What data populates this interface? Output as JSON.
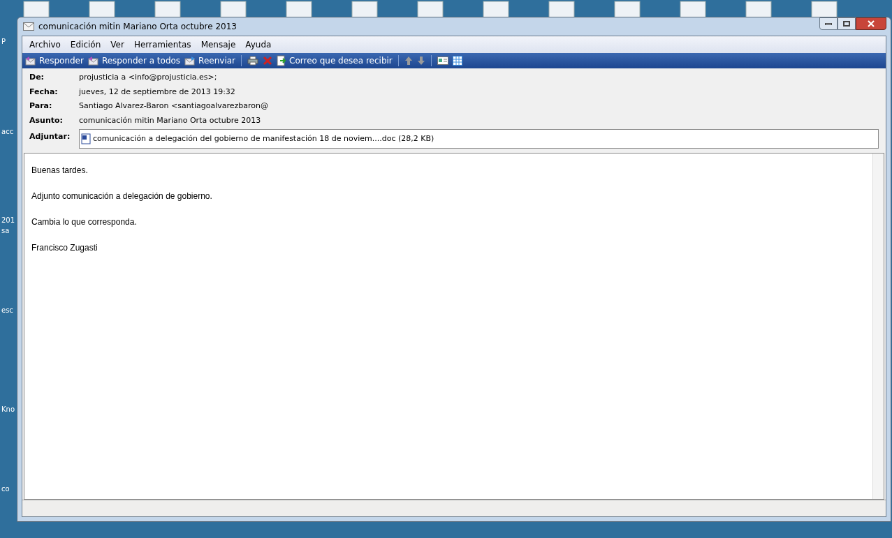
{
  "desktop": {
    "labels": [
      "P",
      "acc",
      "201",
      "sa",
      "esc",
      "Kno",
      "co"
    ]
  },
  "window": {
    "title": "comunicación mitin Mariano Orta octubre 2013"
  },
  "menu": [
    "Archivo",
    "Edición",
    "Ver",
    "Herramientas",
    "Mensaje",
    "Ayuda"
  ],
  "toolbar": [
    {
      "kind": "reply",
      "label": "Responder"
    },
    {
      "kind": "reply-all",
      "label": "Responder a todos"
    },
    {
      "kind": "forward",
      "label": "Reenviar"
    },
    {
      "kind": "sep"
    },
    {
      "kind": "print"
    },
    {
      "kind": "delete"
    },
    {
      "kind": "receipt",
      "label": "Correo que desea recibir"
    },
    {
      "kind": "sep"
    },
    {
      "kind": "up"
    },
    {
      "kind": "down"
    },
    {
      "kind": "sep"
    },
    {
      "kind": "contact"
    },
    {
      "kind": "grid"
    }
  ],
  "header": [
    {
      "label": "De:",
      "value": "projusticia a <info@projusticia.es>;"
    },
    {
      "label": "Fecha:",
      "value": "jueves, 12 de septiembre de 2013 19:32"
    },
    {
      "label": "Para:",
      "value": "Santiago Alvarez-Baron <santiagoalvarezbaron@"
    },
    {
      "label": "Asunto:",
      "value": "comunicación mitin Mariano Orta octubre 2013"
    }
  ],
  "attachment": {
    "label": "Adjuntar:",
    "file": "comunicación a delegación del gobierno de manifestación 18 de noviem....doc (28,2 KB)"
  },
  "body": [
    "Buenas tardes.",
    "Adjunto comunicación a delegación de gobierno.",
    "Cambia lo que corresponda.",
    "Francisco Zugasti"
  ]
}
